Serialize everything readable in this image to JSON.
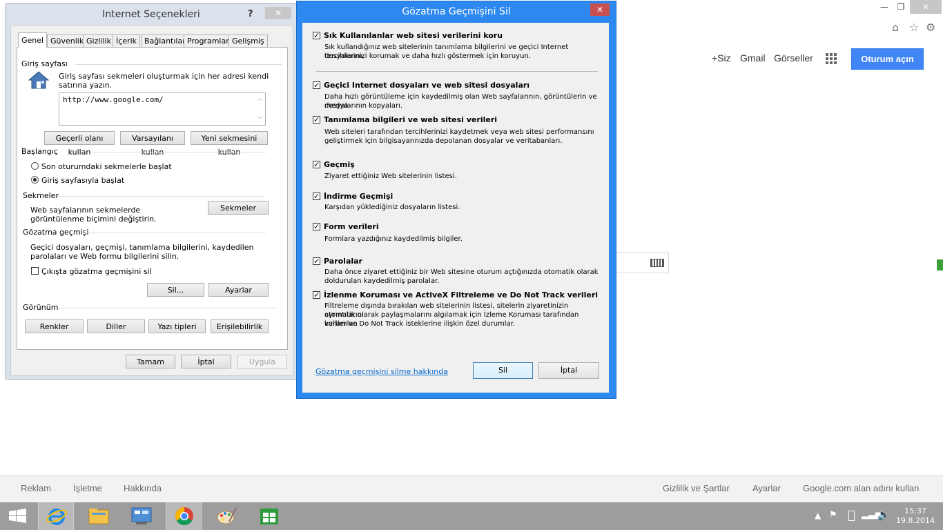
{
  "browser": {
    "window_controls": {
      "minimize": "—",
      "restore": "❐",
      "close": "✕"
    },
    "toolbar_icons": [
      "home-icon",
      "star-icon",
      "gear-icon"
    ],
    "google": {
      "links": [
        "+Siz",
        "Gmail",
        "Görseller"
      ],
      "signin": "Oturum açın"
    },
    "footer": {
      "left": [
        "Reklam",
        "İşletme",
        "Hakkında"
      ],
      "right": [
        "Gizlilik ve Şartlar",
        "Ayarlar",
        "Google.com alan adını kullan"
      ]
    }
  },
  "internet_options": {
    "title": "Internet Seçenekleri",
    "help": "?",
    "close": "✕",
    "tabs": [
      "Genel",
      "Güvenlik",
      "Gizlilik",
      "İçerik",
      "Bağlantılar",
      "Programlar",
      "Gelişmiş"
    ],
    "homepage": {
      "group": "Giriş sayfası",
      "description": "Giriş sayfası sekmeleri oluşturmak için her adresi kendi satırına yazın.",
      "url": "http://www.google.com/",
      "buttons": [
        "Geçerli olanı kullan",
        "Varsayılanı kullan",
        "Yeni sekmesini kullan"
      ]
    },
    "startup": {
      "group": "Başlangıç",
      "options": [
        "Son oturumdaki sekmelerle başlat",
        "Giriş sayfasıyla başlat"
      ]
    },
    "tabs_group": {
      "group": "Sekmeler",
      "description_line1": "Web sayfalarının sekmelerde",
      "description_line2": "görüntülenme biçimini değiştirin.",
      "button": "Sekmeler"
    },
    "history": {
      "group": "Gözatma geçmişi",
      "description_line1": "Geçici dosyaları, geçmişi, tanımlama bilgilerini, kaydedilen",
      "description_line2": "parolaları ve Web formu bilgilerini silin.",
      "checkbox": "Çıkışta gözatma geçmişini sil",
      "buttons": [
        "Sil...",
        "Ayarlar"
      ]
    },
    "appearance": {
      "group": "Görünüm",
      "buttons": [
        "Renkler",
        "Diller",
        "Yazı tipleri",
        "Erişilebilirlik"
      ]
    },
    "footer_buttons": [
      "Tamam",
      "İptal",
      "Uygula"
    ]
  },
  "delete_history": {
    "title": "Gözatma Geçmişini Sil",
    "close": "✕",
    "items": [
      {
        "title": "Sık Kullanılanlar web sitesi verilerini koru",
        "desc1": "Sık kullandığınız web sitelerinin tanımlama bilgilerini ve geçici Internet dosyalarını,",
        "desc2": "tercihlerinizi korumak ve daha hızlı göstermek için koruyun.",
        "desc3": ""
      },
      {
        "title": "Geçici Internet dosyaları ve web sitesi dosyaları",
        "desc1": "Daha hızlı görüntüleme için kaydedilmiş olan Web sayfalarının, görüntülerin ve medya",
        "desc2": "dosyalarının kopyaları.",
        "desc3": ""
      },
      {
        "title": "Tanımlama bilgileri ve web sitesi verileri",
        "desc1": "Web siteleri tarafından tercihlerinizi kaydetmek veya web sitesi performansını",
        "desc2": "geliştirmek için bilgisayarınızda depolanan dosyalar ve veritabanları.",
        "desc3": ""
      },
      {
        "title": "Geçmiş",
        "desc1": "Ziyaret ettiğiniz Web sitelerinin listesi.",
        "desc2": "",
        "desc3": ""
      },
      {
        "title": "İndirme Geçmişi",
        "desc1": "Karşıdan yüklediğiniz dosyaların listesi.",
        "desc2": "",
        "desc3": ""
      },
      {
        "title": "Form verileri",
        "desc1": "Formlara yazdığınız kaydedilmiş bilgiler.",
        "desc2": "",
        "desc3": ""
      },
      {
        "title": "Parolalar",
        "desc1": "Daha önce ziyaret ettiğiniz bir Web sitesine oturum açtığınızda otomatik olarak",
        "desc2": "doldurulan kaydedilmiş parolalar.",
        "desc3": ""
      },
      {
        "title": "İzlenme Koruması ve ActiveX Filtreleme ve Do Not Track verileri",
        "desc1": "Filtreleme dışında bırakılan web sitelerinin listesi, sitelerin ziyaretinizin ayrıntılarını",
        "desc2": "otomatik olarak paylaşmalarını algılamak için İzleme Koruması tarafından kullanılan",
        "desc3": "veriler ve Do Not Track isteklerine ilişkin özel durumlar."
      }
    ],
    "checkmark": "✓",
    "link": "Gözatma geçmişini silme hakkında",
    "buttons": [
      "Sil",
      "İptal"
    ]
  },
  "taskbar": {
    "apps": [
      "start-icon",
      "internet-explorer-icon",
      "file-explorer-icon",
      "control-panel-icon",
      "chrome-icon",
      "paint-icon",
      "store-icon"
    ],
    "time": "15:37",
    "date": "19.8.2014"
  }
}
